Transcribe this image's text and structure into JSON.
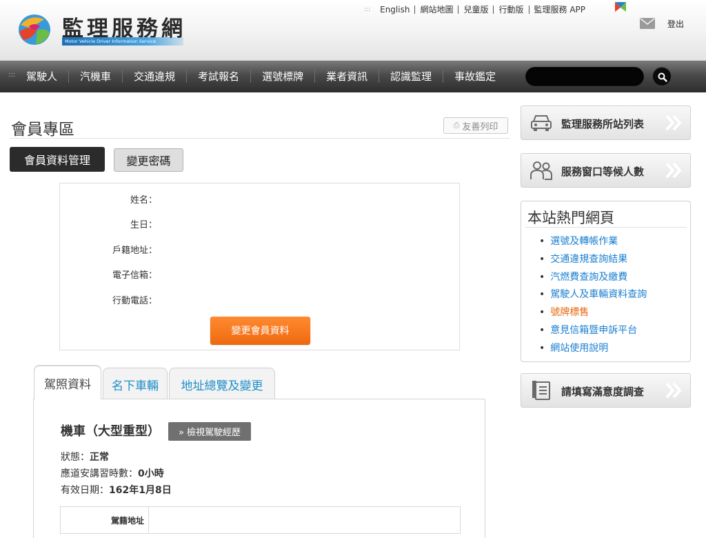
{
  "header": {
    "site_title": "監理服務網",
    "site_subtitle": "Motor Vehicle Driver Information Service",
    "top_links": [
      "English",
      "網站地圖",
      "兒童版",
      "行動版",
      "監理服務 APP"
    ],
    "logout_label": "登出"
  },
  "nav": {
    "items": [
      "駕駛人",
      "汽機車",
      "交通違規",
      "考試報名",
      "選號標牌",
      "業者資訊",
      "認識監理",
      "事故鑑定"
    ],
    "search_value": ""
  },
  "main": {
    "page_title": "會員專區",
    "print_label": "友善列印",
    "tab_manage": "會員資料管理",
    "tab_password": "變更密碼",
    "profile_fields": [
      "姓名：",
      "生日：",
      "戶籍地址：",
      "電子信箱：",
      "行動電話："
    ],
    "edit_button": "變更會員資料",
    "panel_tabs": [
      "駕照資料",
      "名下車輛",
      "地址總覽及變更"
    ],
    "license": {
      "title": "機車（大型重型）",
      "history_button": "» 檢視駕駛經歷",
      "status_label": "狀態：",
      "status_value": "正常",
      "hours_label": "應道安講習時數：",
      "hours_value": "0小時",
      "expiry_label": "有效日期：",
      "expiry_value": "162年1月8日",
      "address_header": "駕籍地址",
      "address_value": ""
    }
  },
  "sidebar": {
    "station_list": "監理服務所站列表",
    "waiting_count": "服務窗口等候人數",
    "hot_title": "本站熱門網頁",
    "hot_links": [
      "選號及轉帳作業",
      "交通違規查詢結果",
      "汽燃費查詢及繳費",
      "駕駛人及車輛資料查詢",
      "號牌標售",
      "意見信箱暨申訴平台",
      "網站使用說明"
    ],
    "survey": "請填寫滿意度調查"
  },
  "colors": {
    "accent_orange": "#f06a0f",
    "link_blue": "#1a7fd0",
    "nav_dark": "#2d2d2d"
  }
}
